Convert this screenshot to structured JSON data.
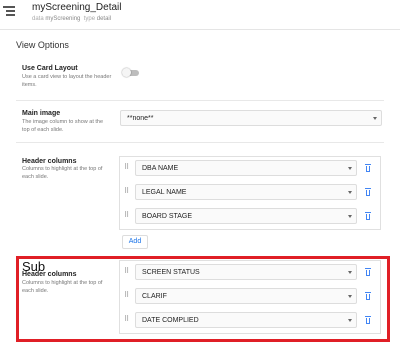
{
  "header": {
    "title": "myScreening_Detail",
    "data_key": "data",
    "data_value": "myScreening",
    "type_key": "type",
    "type_value": "detail"
  },
  "section_title": "View Options",
  "use_card_layout": {
    "label": "Use Card Layout",
    "description": "Use a card view to layout the header items.",
    "enabled": false
  },
  "main_image": {
    "label": "Main image",
    "description": "The image column to show at the top of each slide.",
    "value": "**none**"
  },
  "header_columns": {
    "label": "Header columns",
    "description": "Columns to highlight at the top of each slide.",
    "items": [
      "DBA NAME",
      "LEGAL NAME",
      "BOARD STAGE"
    ],
    "add_label": "Add"
  },
  "sub_header_columns": {
    "annotation": "Sub",
    "label": "Header columns",
    "description": "Columns to highlight at the top of each slide.",
    "items": [
      "SCREEN STATUS",
      "CLARIF",
      "DATE COMPLIED"
    ]
  },
  "colors": {
    "highlight": "#e01f26",
    "accent": "#4285f4",
    "link": "#1a73e8"
  },
  "icons": {
    "view": "view-icon",
    "drag": "drag-handle-icon",
    "delete": "trash-icon",
    "dropdown": "chevron-down-icon"
  }
}
